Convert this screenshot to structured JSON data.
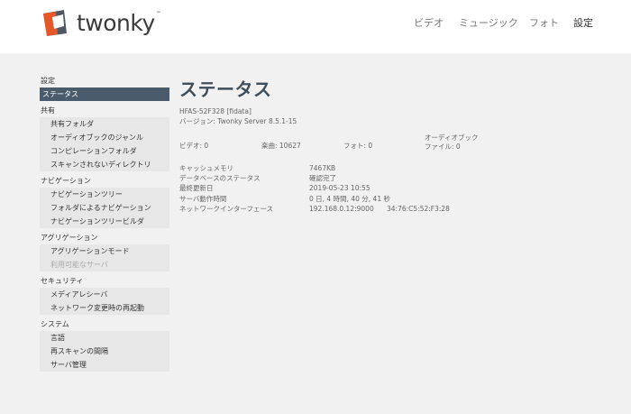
{
  "header": {
    "logo_text": "twonky",
    "logo_tm": "™",
    "nav": {
      "video": "ビデオ",
      "music": "ミュージック",
      "photo": "フォト",
      "settings": "設定"
    }
  },
  "sidebar": {
    "top_heading": "設定",
    "status_item": "ステータス",
    "groups": [
      {
        "heading": "共有",
        "items": [
          "共有フォルダ",
          "オーディオブックのジャンル",
          "コンピレーションフォルダ",
          "スキャンされないディレクトリ"
        ]
      },
      {
        "heading": "ナビゲーション",
        "items": [
          "ナビゲーションツリー",
          "フォルダによるナビゲーション",
          "ナビゲーションツリービルダ"
        ]
      },
      {
        "heading": "アグリゲーション",
        "items": [
          "アグリゲーションモード",
          "利用可能なサーバ"
        ]
      },
      {
        "heading": "セキュリティ",
        "items": [
          "メディアレシーバ",
          "ネットワーク変更時の再起動"
        ]
      },
      {
        "heading": "システム",
        "items": [
          "言語",
          "再スキャンの間隔",
          "サーバ管理"
        ]
      }
    ]
  },
  "main": {
    "title": "ステータス",
    "server_name": "HFAS-52F328 [fidata]",
    "version": "バージョン: Twonky Server 8.5.1-15",
    "counts": {
      "video": "ビデオ: 0",
      "music": "楽曲: 10627",
      "photo": "フォト: 0",
      "audiobook": "オーディオブック ファイル: 0"
    },
    "details": [
      {
        "key": "キャッシュメモリ",
        "value": "7467KB"
      },
      {
        "key": "データベースのステータス",
        "value": "確認完了"
      },
      {
        "key": "最終更新日",
        "value": "2019-05-23 10:55"
      },
      {
        "key": "サーバ動作時間",
        "value": "0 日, 4 時間, 40 分, 41 秒"
      },
      {
        "key": "ネットワークインターフェース",
        "value": "192.168.0.12:9000      34:76:C5:52:F3:28"
      }
    ]
  },
  "colors": {
    "accent": "#4a5c6b",
    "logo_orange": "#e8572a",
    "logo_grey": "#4d5966"
  }
}
